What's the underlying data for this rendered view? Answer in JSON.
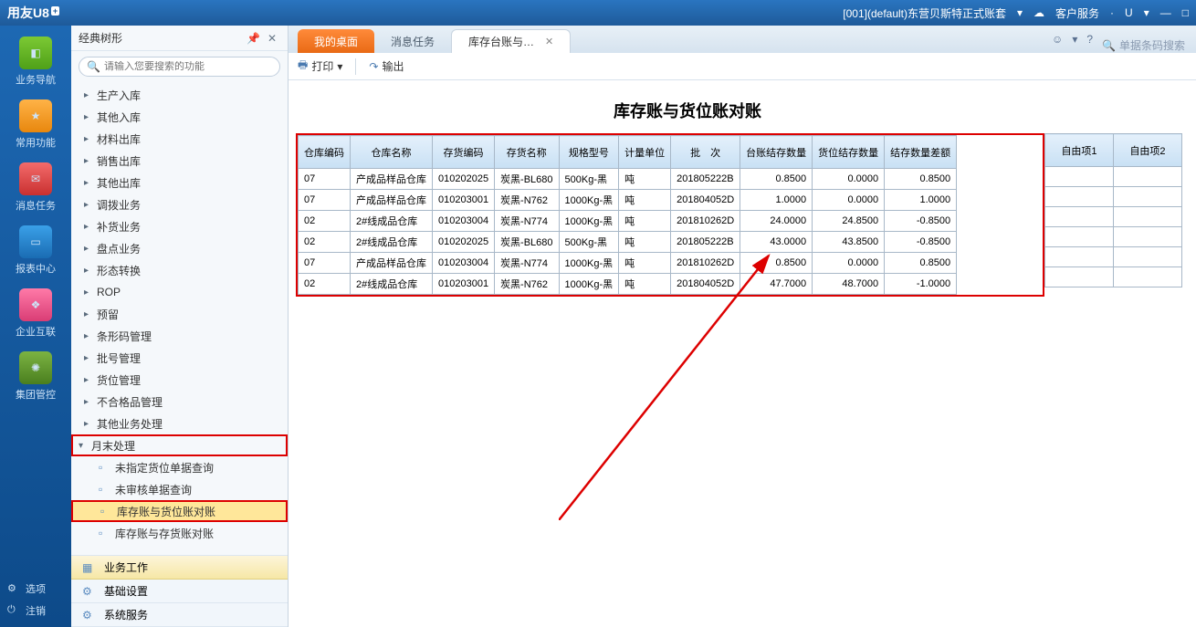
{
  "titlebar": {
    "app_name": "用友",
    "app_suffix": "U8",
    "account_info": "[001](default)东营贝斯特正式账套",
    "service_link": "客户服务",
    "u_indicator": "U"
  },
  "left_rail": {
    "items": [
      {
        "label": "业务导航"
      },
      {
        "label": "常用功能"
      },
      {
        "label": "消息任务"
      },
      {
        "label": "报表中心"
      },
      {
        "label": "企业互联"
      },
      {
        "label": "集团管控"
      }
    ],
    "options": "选项",
    "logout": "注销"
  },
  "tree": {
    "title": "经典树形",
    "search_placeholder": "请输入您要搜索的功能",
    "items": [
      {
        "label": "生产入库"
      },
      {
        "label": "其他入库"
      },
      {
        "label": "材料出库"
      },
      {
        "label": "销售出库"
      },
      {
        "label": "其他出库"
      },
      {
        "label": "调拨业务"
      },
      {
        "label": "补货业务"
      },
      {
        "label": "盘点业务"
      },
      {
        "label": "形态转换"
      },
      {
        "label": "ROP"
      },
      {
        "label": "预留"
      },
      {
        "label": "条形码管理"
      },
      {
        "label": "批号管理"
      },
      {
        "label": "货位管理"
      },
      {
        "label": "不合格品管理"
      },
      {
        "label": "其他业务处理"
      }
    ],
    "month_end": "月末处理",
    "children": [
      {
        "label": "未指定货位单据查询"
      },
      {
        "label": "未审核单据查询"
      },
      {
        "label": "库存账与货位账对账"
      },
      {
        "label": "库存账与存货账对账"
      }
    ],
    "bar_work": "业务工作",
    "bar_basic": "基础设置",
    "bar_sys": "系统服务"
  },
  "tabs": {
    "t1": "我的桌面",
    "t2": "消息任务",
    "t3": "库存台账与…",
    "search_placeholder": "单据条码搜索"
  },
  "toolbar": {
    "print": "打印",
    "export": "输出"
  },
  "report": {
    "title": "库存账与货位账对账",
    "headers": [
      "仓库编码",
      "仓库名称",
      "存货编码",
      "存货名称",
      "规格型号",
      "计量单位",
      "批　次",
      "台账结存数量",
      "货位结存数量",
      "结存数量差额"
    ],
    "extra_headers": [
      "自由项1",
      "自由项2"
    ],
    "rows": [
      [
        "07",
        "产成品样品仓库",
        "010202025",
        "炭黑-BL680",
        "500Kg-黑",
        "吨",
        "201805222B",
        "0.8500",
        "0.0000",
        "0.8500"
      ],
      [
        "07",
        "产成品样品仓库",
        "010203001",
        "炭黑-N762",
        "1000Kg-黑",
        "吨",
        "201804052D",
        "1.0000",
        "0.0000",
        "1.0000"
      ],
      [
        "02",
        "2#线成品仓库",
        "010203004",
        "炭黑-N774",
        "1000Kg-黑",
        "吨",
        "201810262D",
        "24.0000",
        "24.8500",
        "-0.8500"
      ],
      [
        "02",
        "2#线成品仓库",
        "010202025",
        "炭黑-BL680",
        "500Kg-黑",
        "吨",
        "201805222B",
        "43.0000",
        "43.8500",
        "-0.8500"
      ],
      [
        "07",
        "产成品样品仓库",
        "010203004",
        "炭黑-N774",
        "1000Kg-黑",
        "吨",
        "201810262D",
        "0.8500",
        "0.0000",
        "0.8500"
      ],
      [
        "02",
        "2#线成品仓库",
        "010203001",
        "炭黑-N762",
        "1000Kg-黑",
        "吨",
        "201804052D",
        "47.7000",
        "48.7000",
        "-1.0000"
      ]
    ]
  }
}
